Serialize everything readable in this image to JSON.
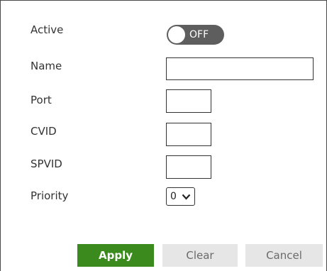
{
  "form": {
    "active": {
      "label": "Active",
      "toggle_text": "OFF",
      "state": "off"
    },
    "name": {
      "label": "Name",
      "value": ""
    },
    "port": {
      "label": "Port",
      "value": ""
    },
    "cvid": {
      "label": "CVID",
      "value": ""
    },
    "spvid": {
      "label": "SPVID",
      "value": ""
    },
    "priority": {
      "label": "Priority",
      "selected": "0"
    }
  },
  "buttons": {
    "apply": "Apply",
    "clear": "Clear",
    "cancel": "Cancel"
  },
  "colors": {
    "apply_bg": "#3a8a1e",
    "toggle_off_bg": "#5e5e5e",
    "secondary_btn_bg": "#e6e6e6"
  },
  "icons": {
    "priority_dropdown": "chevron-down-icon"
  }
}
